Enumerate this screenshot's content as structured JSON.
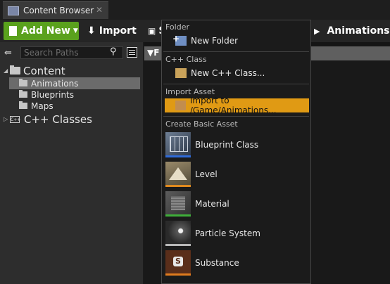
{
  "window": {
    "tab_title": "Content Browser",
    "tab_icon": "content-browser-icon"
  },
  "toolbar": {
    "add_new_label": "Add New",
    "import_label": "Import",
    "save_label": "S",
    "breadcrumb_current": "Animations",
    "add_new_color": "#5aa11d"
  },
  "sidebar": {
    "search_placeholder": "Search Paths",
    "tree": {
      "content": "Content",
      "children": [
        "Animations",
        "Blueprints",
        "Maps"
      ],
      "cpp_classes": "C++ Classes",
      "selected": "Animations"
    }
  },
  "assets": {
    "filter_label": "F"
  },
  "menu": {
    "sections": {
      "folder": "Folder",
      "cpp_class": "C++ Class",
      "import_asset": "Import Asset",
      "create_basic_asset": "Create Basic Asset"
    },
    "new_folder": "New Folder",
    "new_cpp_class": "New C++ Class...",
    "import_to": "Import to /Game/Animations...",
    "basic_assets": [
      "Blueprint Class",
      "Level",
      "Material",
      "Particle System",
      "Substance"
    ],
    "highlight_color": "#e09a14"
  }
}
